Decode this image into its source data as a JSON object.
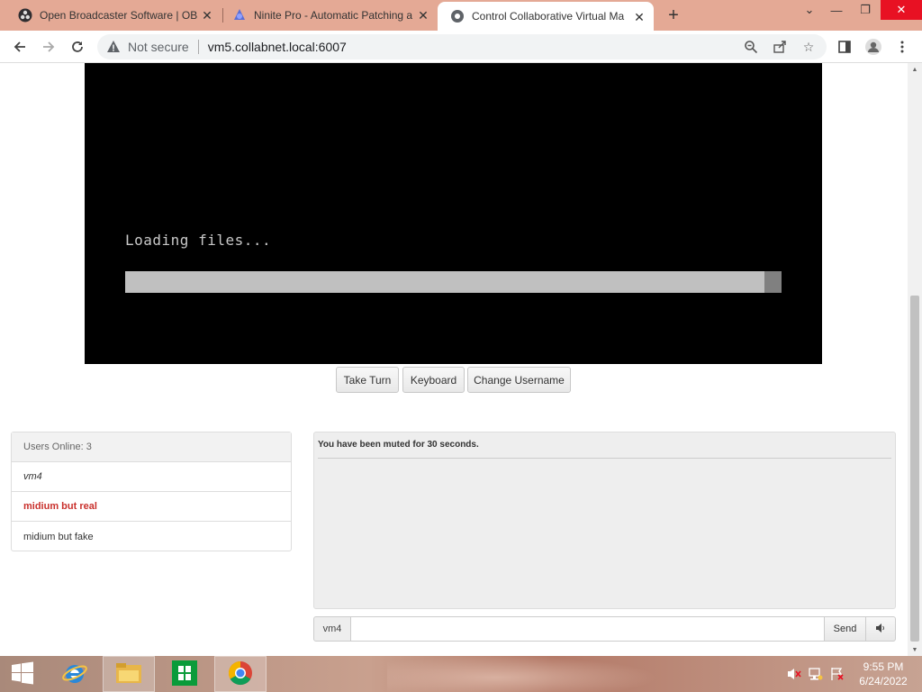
{
  "browser": {
    "tabs": [
      {
        "label": "Open Broadcaster Software | OBS",
        "icon": "obs-icon",
        "active": false
      },
      {
        "label": "Ninite Pro - Automatic Patching a",
        "icon": "ninite-icon",
        "active": false
      },
      {
        "label": "Control Collaborative Virtual Ma",
        "icon": "globe-icon",
        "active": true
      }
    ],
    "address": {
      "security_label": "Not secure",
      "url": "vm5.collabnet.local:6007"
    }
  },
  "vm": {
    "screen_text": "Loading files...",
    "progress": 0.974
  },
  "vm_buttons": {
    "take_turn": "Take Turn",
    "keyboard": "Keyboard",
    "change_username": "Change Username"
  },
  "users": {
    "header": "Users Online: 3",
    "list": [
      "vm4",
      "midium but real",
      "midium but fake"
    ]
  },
  "chat": {
    "messages": [
      "You have been muted for 30 seconds."
    ],
    "username": "vm4",
    "input_value": "",
    "send_label": "Send"
  },
  "taskbar": {
    "time": "9:55 PM",
    "date": "6/24/2022"
  },
  "colors": {
    "titlebar": "#e4a995",
    "highlight_user": "#c9302c"
  }
}
